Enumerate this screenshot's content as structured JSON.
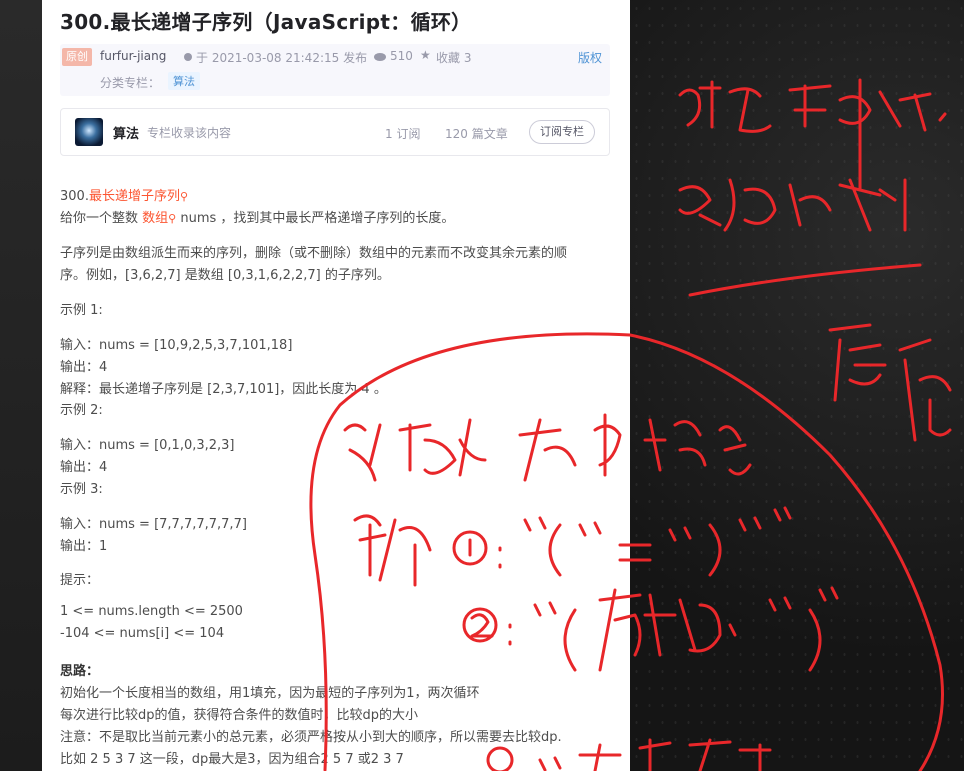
{
  "article": {
    "title": "300.最长递增子序列（JavaScript：循环）",
    "badge": "原创",
    "author": "furfur-jiang",
    "published": "于 2021-03-08 21:42:15 发布",
    "views": "510",
    "favorites": "收藏 3",
    "copyright": "版权",
    "category_label": "分类专栏：",
    "category_tag": "算法"
  },
  "column": {
    "name": "算法",
    "desc": "专栏收录该内容",
    "subscribers": "1 订阅",
    "articles": "120 篇文章",
    "button": "订阅专栏"
  },
  "content": {
    "problem_prefix": "300.",
    "problem_link": "最长递增子序列",
    "intro_a": "给你一个整数",
    "intro_link": "数组",
    "intro_b": "nums ，找到其中最长严格递增子序列的长度。",
    "def1": "子序列是由数组派生而来的序列，删除（或不删除）数组中的元素而不改变其余元素的顺",
    "def2": "序。例如，[3,6,2,7] 是数组 [0,3,1,6,2,2,7] 的子序列。",
    "ex1_title": "示例 1:",
    "ex1_input": "输入：nums = [10,9,2,5,3,7,101,18]",
    "ex1_output": "输出：4",
    "ex1_explain": "解释：最长递增子序列是 [2,3,7,101]，因此长度为 4 。",
    "ex2_title": "示例 2:",
    "ex2_input": "输入：nums = [0,1,0,3,2,3]",
    "ex2_output": "输出：4",
    "ex3_title": "示例 3:",
    "ex3_input": "输入：nums = [7,7,7,7,7,7,7]",
    "ex3_output": "输出：1",
    "hint_title": "提示：",
    "hint1": "1 <= nums.length <= 2500",
    "hint2": "-104 <= nums[i] <= 104",
    "idea_title": "思路：",
    "idea1": "初始化一个长度相当的数组，用1填充，因为最短的子序列为1，两次循环",
    "idea2": "每次进行比较dp的值，获得符合条件的数值时，比较dp的大小",
    "idea3": "注意：不是取比当前元素小的总元素，必须严格按从小到大的顺序，所以需要去比较dp.",
    "idea4": "比如 2 5 3 7 这一段，dp最大是3，因为组合2 5 7 或2 3 7"
  },
  "colors": {
    "ink": "#e8272a",
    "link": "#fc5531",
    "accent": "#5094d5"
  }
}
